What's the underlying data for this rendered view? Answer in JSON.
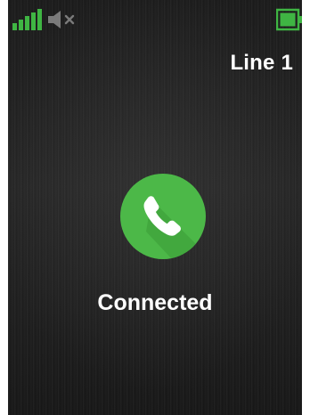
{
  "status_bar": {
    "signal_icon": "signal-strength-icon",
    "signal_level": 5,
    "signal_max": 5,
    "speaker_icon": "speaker-muted-icon",
    "speaker_muted": true,
    "battery_icon": "battery-icon",
    "battery_level": 1.0
  },
  "call": {
    "line_label": "Line 1",
    "status_text": "Connected",
    "call_icon": "phone-handset-icon"
  },
  "colors": {
    "accent_green": "#4cb848",
    "accent_green_shadow": "#3a9a37",
    "text": "#ffffff",
    "background": "#1e1e1e"
  }
}
